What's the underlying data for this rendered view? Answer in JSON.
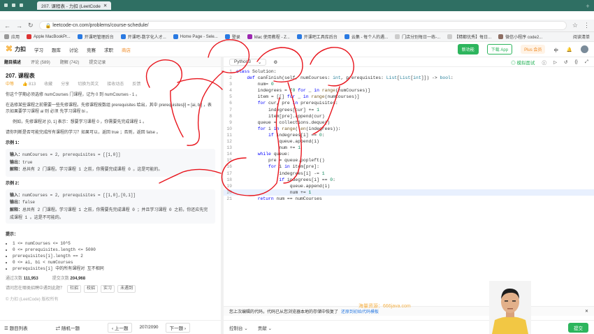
{
  "browser": {
    "tab_title": "207. 课程表 - 力扣 (LeetCode",
    "url": "leetcode-cn.com/problems/course-schedule/",
    "bookmarks": [
      "应用",
      "Apple MacBookPr...",
      "开课吧管理后台",
      "开课吧-数字化人才...",
      "Home Page - Sele...",
      "登录",
      "Mac 使用教程 - Z...",
      "开课吧工具库后台",
      "云集 - 每个人的遇...",
      "门店分别每日一练-...",
      "【精都优秀】每日...",
      "微信小程序 code2..."
    ],
    "reading_list": "阅读清单"
  },
  "lc_nav": {
    "logo": "力扣",
    "items": [
      "学习",
      "题库",
      "讨论",
      "竞赛",
      "求职",
      "商店"
    ],
    "download": "下载 App",
    "plus": "Plus 会员",
    "lang": "中",
    "badge": "新功能"
  },
  "left_tabs": [
    "题目描述",
    "评论 (589)",
    "题解 (742)",
    "提交记录"
  ],
  "problem": {
    "title": "207. 课程表",
    "difficulty": "中等",
    "likes": "813",
    "fav": "收藏",
    "share": "分享",
    "english": "切换为英文",
    "follow": "接收动态",
    "feedback": "反馈",
    "p1": "你这个学期必须选修 numCourses 门课程，记为 0 到 numCourses - 1 。",
    "p2": "在选修某些课程之前需要一些先修课程。先修课程按数组 prerequisites 给出，其中 prerequisites[i] = [ai, bi] ，表示如果要学习课程 ai 则 必须 先学习课程 bi 。",
    "p3": "例如，先修课程对 [0, 1] 表示：想要学习课程 0 ，你需要先完成课程 1 。",
    "p4": "请你判断是否可能完成所有课程的学习？如果可以，返回 true ；否则，返回 false 。",
    "ex1_title": "示例 1：",
    "ex1_input": "numCourses = 2, prerequisites = [[1,0]]",
    "ex1_output": "true",
    "ex1_explain": "总共有 2 门课程。学习课程 1 之前，你需要完成课程 0 。这是可能的。",
    "ex2_title": "示例 2：",
    "ex2_input": "numCourses = 2, prerequisites = [[1,0],[0,1]]",
    "ex2_output": "false",
    "ex2_explain": "总共有 2 门课程。学习课程 1 之前，你需要先完成课程 0 ；并且学习课程 0 之前，你还应先完成课程 1 。这是不可能的。",
    "input_label": "输入：",
    "output_label": "输出：",
    "explain_label": "解释：",
    "constraints_title": "提示：",
    "constraints": [
      "1 <= numCourses <= 10^5",
      "0 <= prerequisites.length <= 5000",
      "prerequisites[i].length == 2",
      "0 <= ai, bi < numCourses",
      "prerequisites[i] 中的所有课程对 互不相同"
    ],
    "pass_label": "通过次数",
    "pass_value": "111,953",
    "submit_label": "提交次数",
    "submit_value": "204,968",
    "interview_q": "请问您在哪类招聘中遇到此题？",
    "interview_tags": [
      "社招",
      "校招",
      "实习",
      "未遇到"
    ],
    "copyright": "© 力扣 (LeetCode) 版权所有"
  },
  "left_bottom": {
    "list": "题目列表",
    "random": "随机一题",
    "prev": "上一题",
    "counter": "207/2090",
    "next": "下一题"
  },
  "editor": {
    "language": "Python3",
    "mock": "模拟面试",
    "code_lines": [
      "class Solution:",
      "    def canFinish(self, numCourses: int, prerequisites: List[List[int]]) -> bool:",
      "        num= 0",
      "        indegrees = [0 for _ in range(numCourses)]",
      "        item = [[] for _ in range(numCourses)]",
      "        for cur, pre in prerequisites:",
      "            indegrees[cur] += 1",
      "            item[pre].append(cur)",
      "        queue = collections.deque()",
      "        for i in range(len(indegrees)):",
      "            if indegrees[i] == 0:",
      "                queue.append(i)",
      "                num += 1",
      "        while queue:",
      "            pre = queue.popleft()",
      "            for i in item[pre]:",
      "                indegrees[i] -= 1",
      "                if indegrees[i] == 0:",
      "                    queue.append(i)",
      "                    num += 1",
      "        return num == numCourses"
    ],
    "highlight_line": 20
  },
  "console": {
    "message": "您上次编辑的代码，代码已从您浏览器本地的存储中恢复了",
    "restore_link": "还原到初始代码模板",
    "console_label": "控制台",
    "contribute": "贡献",
    "submit": "提交"
  },
  "watermark": "海量资源：666java.com",
  "colors": {
    "accent": "#2db55d",
    "annotation": "#e8141c",
    "os_bar": "#2f6f63"
  }
}
